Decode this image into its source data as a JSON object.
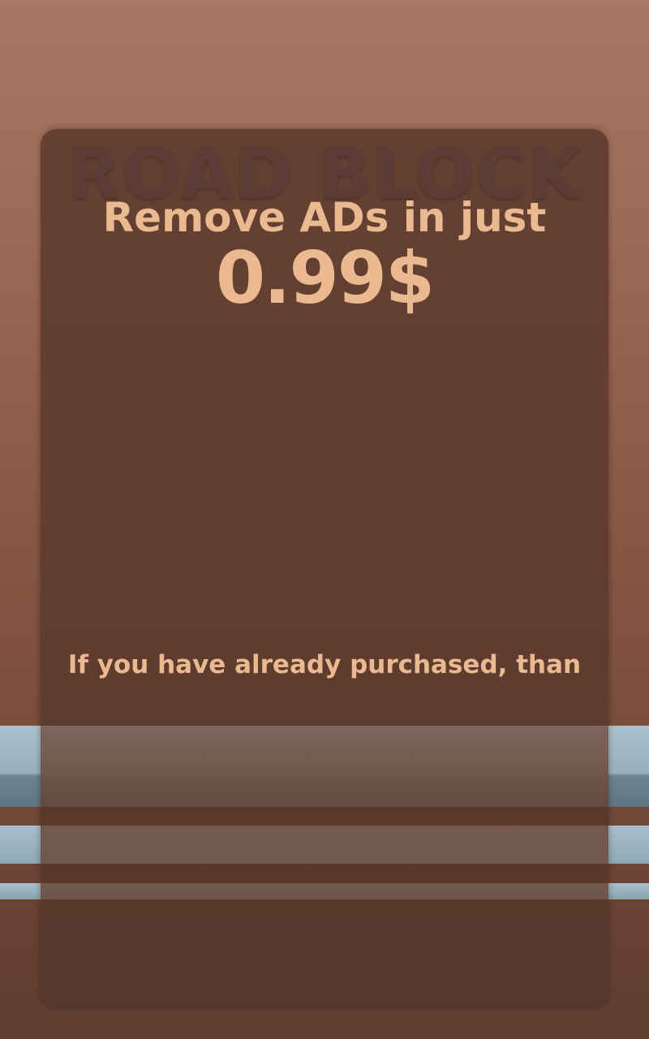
{
  "background": {
    "title_watermark": "ROAD BLOCK"
  },
  "dialog": {
    "headline": "Remove ADs in just",
    "price": "0.99$",
    "purchased_note": "If you have already purchased, than"
  },
  "colors": {
    "text_accent": "#eab98f",
    "panel": "#603d30",
    "stripe": "#a9c1cd"
  }
}
